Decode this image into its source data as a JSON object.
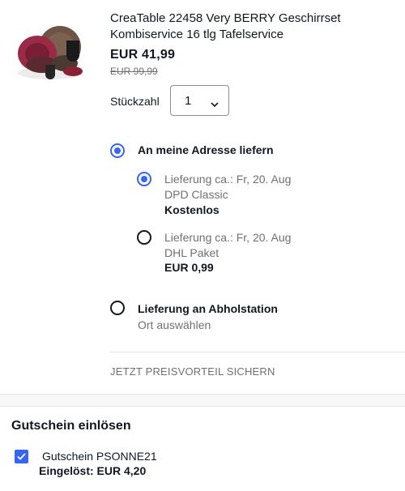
{
  "product": {
    "title": "CreaTable 22458 Very BERRY Geschirrset Kombiservice 16 tlg Tafelservice",
    "price": "EUR 41,99",
    "old_price": "EUR 99,99",
    "image_icon": "dinnerware-set-image"
  },
  "quantity": {
    "label": "Stückzahl",
    "value": "1"
  },
  "delivery": {
    "home": {
      "label": "An meine Adresse liefern",
      "selected": true,
      "options": [
        {
          "date": "Lieferung ca.: Fr, 20. Aug",
          "carrier": "DPD Classic",
          "cost": "Kostenlos",
          "selected": true
        },
        {
          "date": "Lieferung ca.: Fr, 20. Aug",
          "carrier": "DHL Paket",
          "cost": "EUR 0,99",
          "selected": false
        }
      ]
    },
    "pickup": {
      "label": "Lieferung an Abholstation",
      "sub": "Ort auswählen",
      "selected": false
    }
  },
  "promo_link": "JETZT PREISVORTEIL SICHERN",
  "coupon": {
    "heading": "Gutschein einlösen",
    "name": "Gutschein PSONNE21",
    "redeemed": "Eingelöst: EUR 4,20",
    "checked": true
  },
  "colors": {
    "accent": "#3665f3",
    "text": "#111820",
    "muted": "#707070"
  }
}
